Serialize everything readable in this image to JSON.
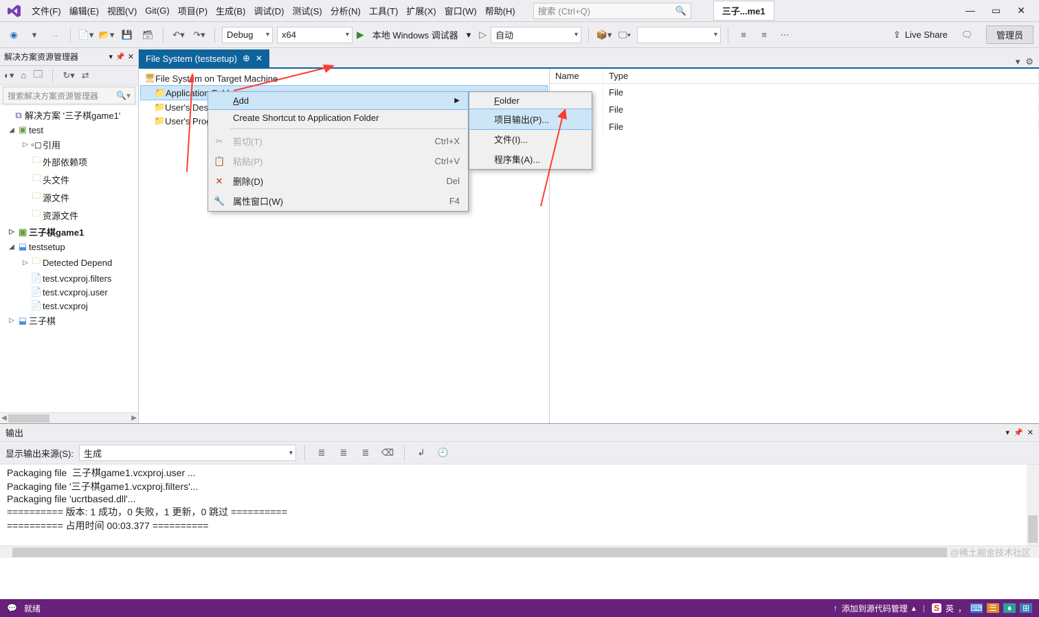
{
  "menubar": {
    "items": [
      "文件(F)",
      "编辑(E)",
      "视图(V)",
      "Git(G)",
      "项目(P)",
      "生成(B)",
      "调试(D)",
      "测试(S)",
      "分析(N)",
      "工具(T)",
      "扩展(X)",
      "窗口(W)",
      "帮助(H)"
    ],
    "search_placeholder": "搜索 (Ctrl+Q)",
    "doc_title": "三子...me1"
  },
  "toolbar": {
    "config": "Debug",
    "platform": "x64",
    "debug_target": "本地 Windows 调试器",
    "run_mode": "自动",
    "live_share": "Live Share",
    "admin": "管理员"
  },
  "solution_explorer": {
    "title": "解决方案资源管理器",
    "search_placeholder": "搜索解决方案资源管理器",
    "tree": {
      "solution": "解决方案 '三子棋game1'",
      "proj_test": "test",
      "ref": "引用",
      "ext_deps": "外部依赖项",
      "headers": "头文件",
      "sources": "源文件",
      "resources": "资源文件",
      "proj_game": "三子棋game1",
      "proj_setup": "testsetup",
      "detected": "Detected Depend",
      "file1": "test.vcxproj.filters",
      "file2": "test.vcxproj.user",
      "file3": "test.vcxproj",
      "proj_sanzi": "三子棋"
    }
  },
  "doc_tab": {
    "title": "File System (testsetup)"
  },
  "fs": {
    "root": "File System on Target Machine",
    "app_folder": "Application Folder",
    "desktop": "User's Desktop",
    "programs": "User's Programs Menu",
    "col_name": "Name",
    "col_type": "Type",
    "file_type": "File"
  },
  "context_menu": {
    "add": "Add",
    "shortcut": "Create Shortcut to Application Folder",
    "cut": "剪切(T)",
    "cut_key": "Ctrl+X",
    "paste": "粘贴(P)",
    "paste_key": "Ctrl+V",
    "delete": "删除(D)",
    "delete_key": "Del",
    "props": "属性窗口(W)",
    "props_key": "F4"
  },
  "submenu": {
    "folder": "Folder",
    "proj_output": "项目输出(P)...",
    "file": "文件(I)...",
    "assembly": "程序集(A)..."
  },
  "output": {
    "title": "输出",
    "source_label": "显示输出来源(S):",
    "source": "生成",
    "lines": [
      "Packaging file  三子棋game1.vcxproj.user ...",
      "Packaging file '三子棋game1.vcxproj.filters'...",
      "Packaging file 'ucrtbased.dll'...",
      "========== 版本: 1 成功，0 失败，1 更新，0 跳过 ==========",
      "========== 占用时间 00:03.377 =========="
    ]
  },
  "statusbar": {
    "ready": "就绪",
    "source_control": "添加到源代码管理",
    "ime": "英"
  },
  "watermark": "@稀土掘金技术社区"
}
